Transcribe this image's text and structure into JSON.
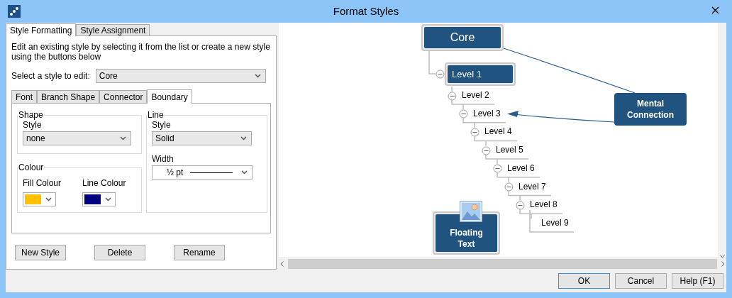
{
  "window": {
    "title": "Format Styles"
  },
  "tabs": [
    {
      "label": "Style Formatting",
      "selected": true
    },
    {
      "label": "Style Assignment",
      "selected": false
    }
  ],
  "description": "Edit an existing style by selecting it from the list or create a new style using the buttons below",
  "style_select": {
    "label": "Select a style to edit:",
    "value": "Core"
  },
  "subtabs": [
    {
      "label": "Font",
      "selected": false
    },
    {
      "label": "Branch Shape",
      "selected": false
    },
    {
      "label": "Connector",
      "selected": false
    },
    {
      "label": "Boundary",
      "selected": true
    }
  ],
  "shape": {
    "title": "Shape",
    "style_label": "Style",
    "style_value": "none"
  },
  "colour": {
    "title": "Colour",
    "pickers": [
      {
        "label": "Fill Colour",
        "color": "#ffc000"
      },
      {
        "label": "Line Colour",
        "color": "#000080"
      }
    ]
  },
  "line": {
    "title": "Line",
    "style_label": "Style",
    "style_value": "Solid",
    "width_label": "Width",
    "width_value": "½ pt"
  },
  "style_buttons": [
    "New Style",
    "Delete",
    "Rename"
  ],
  "mind_map": {
    "core": {
      "label": "Core",
      "children": [
        {
          "label": "Level 1",
          "children": [
            {
              "label": "Level 2",
              "children": [
                {
                  "label": "Level 3",
                  "children": [
                    {
                      "label": "Level 4",
                      "children": [
                        {
                          "label": "Level 5",
                          "children": [
                            {
                              "label": "Level 6",
                              "children": [
                                {
                                  "label": "Level 7",
                                  "children": [
                                    {
                                      "label": "Level 8",
                                      "children": [
                                        {
                                          "label": "Level 9"
                                        }
                                      ]
                                    }
                                  ]
                                }
                              ]
                            }
                          ]
                        }
                      ]
                    }
                  ]
                }
              ]
            }
          ]
        }
      ]
    },
    "mental_connection": "Mental Connection",
    "floating_text": "Floating Text"
  },
  "dialog_buttons": [
    {
      "label": "OK",
      "default": true
    },
    {
      "label": "Cancel",
      "default": false
    },
    {
      "label": "Help (F1)",
      "default": false
    }
  ]
}
